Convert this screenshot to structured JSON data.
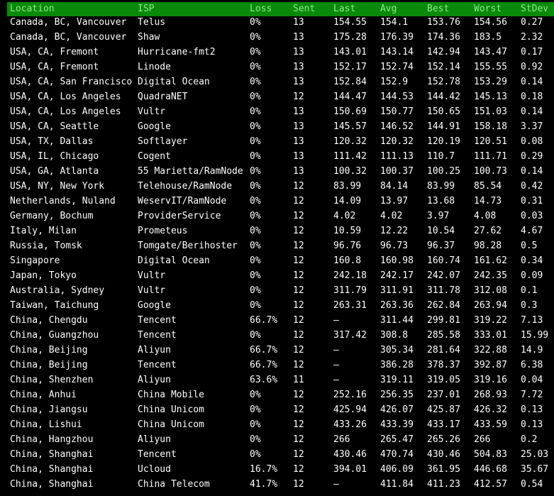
{
  "columns": {
    "location": "Location",
    "isp": "ISP",
    "loss": "Loss",
    "sent": "Sent",
    "last": "Last",
    "avg": "Avg",
    "best": "Best",
    "worst": "Worst",
    "stdev": "StDev"
  },
  "header_color": "#0a8a0a",
  "rows": [
    {
      "location": "Canada, BC, Vancouver",
      "isp": "Telus",
      "loss": "0%",
      "sent": "13",
      "last": "154.55",
      "avg": "154.1",
      "best": "153.76",
      "worst": "154.56",
      "stdev": "0.27"
    },
    {
      "location": "Canada, BC, Vancouver",
      "isp": "Shaw",
      "loss": "0%",
      "sent": "13",
      "last": "175.28",
      "avg": "176.39",
      "best": "174.36",
      "worst": "183.5",
      "stdev": "2.32"
    },
    {
      "location": "USA, CA, Fremont",
      "isp": "Hurricane-fmt2",
      "loss": "0%",
      "sent": "13",
      "last": "143.01",
      "avg": "143.14",
      "best": "142.94",
      "worst": "143.47",
      "stdev": "0.17"
    },
    {
      "location": "USA, CA, Fremont",
      "isp": "Linode",
      "loss": "0%",
      "sent": "13",
      "last": "152.17",
      "avg": "152.74",
      "best": "152.14",
      "worst": "155.55",
      "stdev": "0.92"
    },
    {
      "location": "USA, CA, San Francisco",
      "isp": "Digital Ocean",
      "loss": "0%",
      "sent": "13",
      "last": "152.84",
      "avg": "152.9",
      "best": "152.78",
      "worst": "153.29",
      "stdev": "0.14"
    },
    {
      "location": "USA, CA, Los Angeles",
      "isp": "QuadraNET",
      "loss": "0%",
      "sent": "12",
      "last": "144.47",
      "avg": "144.53",
      "best": "144.42",
      "worst": "145.13",
      "stdev": "0.18"
    },
    {
      "location": "USA, CA, Los Angeles",
      "isp": "Vultr",
      "loss": "0%",
      "sent": "13",
      "last": "150.69",
      "avg": "150.77",
      "best": "150.65",
      "worst": "151.03",
      "stdev": "0.14"
    },
    {
      "location": "USA, CA, Seattle",
      "isp": "Google",
      "loss": "0%",
      "sent": "13",
      "last": "145.57",
      "avg": "146.52",
      "best": "144.91",
      "worst": "158.18",
      "stdev": "3.37"
    },
    {
      "location": "USA, TX, Dallas",
      "isp": "Softlayer",
      "loss": "0%",
      "sent": "13",
      "last": "120.32",
      "avg": "120.32",
      "best": "120.19",
      "worst": "120.51",
      "stdev": "0.08"
    },
    {
      "location": "USA, IL, Chicago",
      "isp": "Cogent",
      "loss": "0%",
      "sent": "13",
      "last": "111.42",
      "avg": "111.13",
      "best": "110.7",
      "worst": "111.71",
      "stdev": "0.29"
    },
    {
      "location": "USA, GA, Atlanta",
      "isp": "55 Marietta/RamNode",
      "loss": "0%",
      "sent": "13",
      "last": "100.32",
      "avg": "100.37",
      "best": "100.25",
      "worst": "100.73",
      "stdev": "0.14"
    },
    {
      "location": "USA, NY, New York",
      "isp": "Telehouse/RamNode",
      "loss": "0%",
      "sent": "12",
      "last": "83.99",
      "avg": "84.14",
      "best": "83.99",
      "worst": "85.54",
      "stdev": "0.42"
    },
    {
      "location": "Netherlands, Nuland",
      "isp": "WeservIT/RamNode",
      "loss": "0%",
      "sent": "12",
      "last": "14.09",
      "avg": "13.97",
      "best": "13.68",
      "worst": "14.73",
      "stdev": "0.31"
    },
    {
      "location": "Germany, Bochum",
      "isp": "ProviderService",
      "loss": "0%",
      "sent": "12",
      "last": "4.02",
      "avg": "4.02",
      "best": "3.97",
      "worst": "4.08",
      "stdev": "0.03"
    },
    {
      "location": "Italy, Milan",
      "isp": "Prometeus",
      "loss": "0%",
      "sent": "12",
      "last": "10.59",
      "avg": "12.22",
      "best": "10.54",
      "worst": "27.62",
      "stdev": "4.67"
    },
    {
      "location": "Russia, Tomsk",
      "isp": "Tomgate/Berihoster",
      "loss": "0%",
      "sent": "12",
      "last": "96.76",
      "avg": "96.73",
      "best": "96.37",
      "worst": "98.28",
      "stdev": "0.5"
    },
    {
      "location": "Singapore",
      "isp": "Digital Ocean",
      "loss": "0%",
      "sent": "12",
      "last": "160.8",
      "avg": "160.98",
      "best": "160.74",
      "worst": "161.62",
      "stdev": "0.34"
    },
    {
      "location": "Japan, Tokyo",
      "isp": "Vultr",
      "loss": "0%",
      "sent": "12",
      "last": "242.18",
      "avg": "242.17",
      "best": "242.07",
      "worst": "242.35",
      "stdev": "0.09"
    },
    {
      "location": "Australia, Sydney",
      "isp": "Vultr",
      "loss": "0%",
      "sent": "12",
      "last": "311.79",
      "avg": "311.91",
      "best": "311.78",
      "worst": "312.08",
      "stdev": "0.1"
    },
    {
      "location": "Taiwan, Taichung",
      "isp": "Google",
      "loss": "0%",
      "sent": "12",
      "last": "263.31",
      "avg": "263.36",
      "best": "262.84",
      "worst": "263.94",
      "stdev": "0.3"
    },
    {
      "location": "China, Chengdu",
      "isp": "Tencent",
      "loss": "66.7%",
      "sent": "12",
      "last": "–",
      "avg": "311.44",
      "best": "299.81",
      "worst": "319.22",
      "stdev": "7.13"
    },
    {
      "location": "China, Guangzhou",
      "isp": "Tencent",
      "loss": "0%",
      "sent": "12",
      "last": "317.42",
      "avg": "308.8",
      "best": "285.58",
      "worst": "333.01",
      "stdev": "15.99"
    },
    {
      "location": "China, Beijing",
      "isp": "Aliyun",
      "loss": "66.7%",
      "sent": "12",
      "last": "–",
      "avg": "305.34",
      "best": "281.64",
      "worst": "322.88",
      "stdev": "14.9"
    },
    {
      "location": "China, Beijing",
      "isp": "Tencent",
      "loss": "66.7%",
      "sent": "12",
      "last": "–",
      "avg": "386.28",
      "best": "378.37",
      "worst": "392.87",
      "stdev": "6.38"
    },
    {
      "location": "China, Shenzhen",
      "isp": "Aliyun",
      "loss": "63.6%",
      "sent": "11",
      "last": "–",
      "avg": "319.11",
      "best": "319.05",
      "worst": "319.16",
      "stdev": "0.04"
    },
    {
      "location": "China, Anhui",
      "isp": "China Mobile",
      "loss": "0%",
      "sent": "12",
      "last": "252.16",
      "avg": "256.35",
      "best": "237.01",
      "worst": "268.93",
      "stdev": "7.72"
    },
    {
      "location": "China, Jiangsu",
      "isp": "China Unicom",
      "loss": "0%",
      "sent": "12",
      "last": "425.94",
      "avg": "426.07",
      "best": "425.87",
      "worst": "426.32",
      "stdev": "0.13"
    },
    {
      "location": "China, Lishui",
      "isp": "China Unicom",
      "loss": "0%",
      "sent": "12",
      "last": "433.26",
      "avg": "433.39",
      "best": "433.17",
      "worst": "433.59",
      "stdev": "0.13"
    },
    {
      "location": "China, Hangzhou",
      "isp": "Aliyun",
      "loss": "0%",
      "sent": "12",
      "last": "266",
      "avg": "265.47",
      "best": "265.26",
      "worst": "266",
      "stdev": "0.2"
    },
    {
      "location": "China, Shanghai",
      "isp": "Tencent",
      "loss": "0%",
      "sent": "12",
      "last": "430.46",
      "avg": "470.74",
      "best": "430.46",
      "worst": "504.83",
      "stdev": "25.03"
    },
    {
      "location": "China, Shanghai",
      "isp": "Ucloud",
      "loss": "16.7%",
      "sent": "12",
      "last": "394.01",
      "avg": "406.09",
      "best": "361.95",
      "worst": "446.68",
      "stdev": "35.67"
    },
    {
      "location": "China, Shanghai",
      "isp": "China Telecom",
      "loss": "41.7%",
      "sent": "12",
      "last": "–",
      "avg": "411.84",
      "best": "411.23",
      "worst": "412.57",
      "stdev": "0.54"
    }
  ]
}
